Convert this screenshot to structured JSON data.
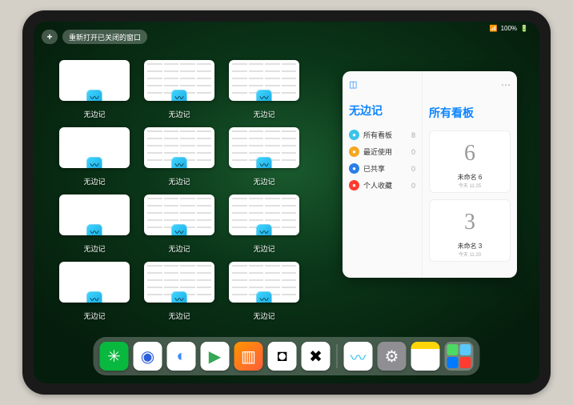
{
  "top_bar": {
    "add_label": "+",
    "reopen_label": "重新打开已关闭的窗口",
    "status": "100%"
  },
  "app_windows": {
    "app_name": "无边记",
    "items": [
      {
        "label": "无边记",
        "variant": "blank"
      },
      {
        "label": "无边记",
        "variant": "grid"
      },
      {
        "label": "无边记",
        "variant": "grid"
      },
      {
        "label": "无边记",
        "variant": "blank"
      },
      {
        "label": "无边记",
        "variant": "grid"
      },
      {
        "label": "无边记",
        "variant": "grid"
      },
      {
        "label": "无边记",
        "variant": "blank"
      },
      {
        "label": "无边记",
        "variant": "grid"
      },
      {
        "label": "无边记",
        "variant": "grid"
      },
      {
        "label": "无边记",
        "variant": "blank"
      },
      {
        "label": "无边记",
        "variant": "grid"
      },
      {
        "label": "无边记",
        "variant": "grid"
      }
    ]
  },
  "panel": {
    "title": "无边记",
    "items": [
      {
        "icon_color": "#3ac3e8",
        "label": "所有看板",
        "count": "8"
      },
      {
        "icon_color": "#f5a623",
        "label": "最近使用",
        "count": "0"
      },
      {
        "icon_color": "#2b7de9",
        "label": "已共享",
        "count": "0"
      },
      {
        "icon_color": "#ff3b30",
        "label": "个人收藏",
        "count": "0"
      }
    ],
    "right_title": "所有看板",
    "boards": [
      {
        "glyph": "6",
        "label": "未命名 6",
        "time": "今天 11:25"
      },
      {
        "glyph": "3",
        "label": "未命名 3",
        "time": "今天 11:20"
      }
    ]
  },
  "dock": {
    "icons": [
      {
        "name": "wechat-icon",
        "bg": "#09b83e",
        "glyph": "✳"
      },
      {
        "name": "qqbrowser-icon",
        "bg": "#ffffff",
        "glyph": "◉",
        "fg": "#2b5fd9"
      },
      {
        "name": "quark-icon",
        "bg": "#ffffff",
        "glyph": "◐",
        "fg": "#3d8bff"
      },
      {
        "name": "play-icon",
        "bg": "#ffffff",
        "glyph": "▶",
        "fg": "#34a853"
      },
      {
        "name": "books-icon",
        "bg": "linear-gradient(135deg,#ff9500,#ff5e3a)",
        "glyph": "▥"
      },
      {
        "name": "app6-icon",
        "bg": "#ffffff",
        "glyph": "◘",
        "fg": "#000"
      },
      {
        "name": "app7-icon",
        "bg": "#ffffff",
        "glyph": "✖",
        "fg": "#000"
      }
    ],
    "recent": [
      {
        "name": "freeform-icon",
        "bg": "#ffffff",
        "glyph": "〰",
        "fg": "#3ac3e8"
      },
      {
        "name": "settings-icon",
        "bg": "#8e8e93",
        "glyph": "⚙"
      },
      {
        "name": "notes-icon",
        "bg": "linear-gradient(#ffd60a 25%,#fff 25%)",
        "glyph": ""
      },
      {
        "name": "library-icon",
        "bg": "grid"
      }
    ]
  }
}
